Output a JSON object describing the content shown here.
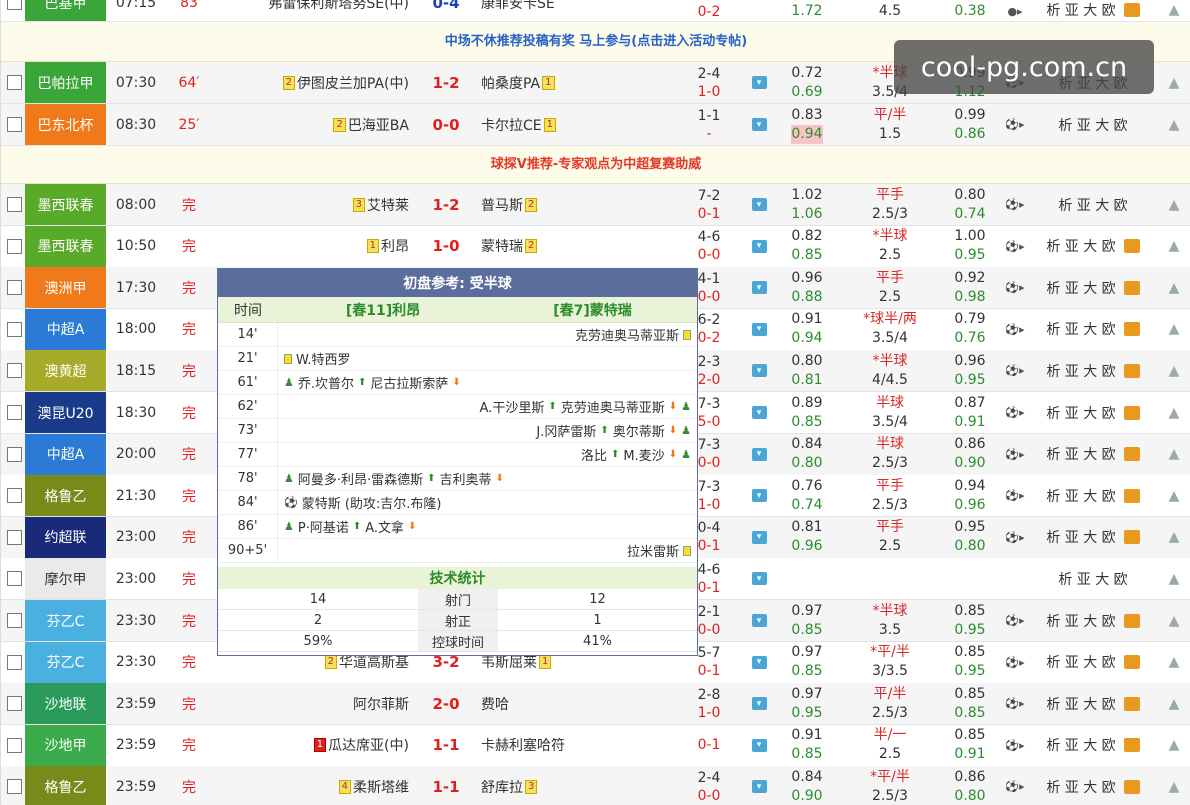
{
  "top_row": {
    "league": "巴基甲",
    "league_color": "#3aa63a",
    "time": "07:15",
    "status": "83",
    "home": "弗雷保利斯塔努SE(中)",
    "score": "0-4",
    "away": "康菲安卡SE",
    "hf_top": "0-2",
    "hf_bottom": "",
    "o1a": "1.72",
    "o2a": "4.5",
    "o3a": "0.38"
  },
  "banners": {
    "b1": "中场不休推荐投稿有奖 马上参与(点击进入活动专帖)",
    "b2": "球探V推荐-专家观点为中超复赛助威"
  },
  "live_rows": [
    {
      "league": "巴帕拉甲",
      "color": "#3aa63a",
      "time": "07:30",
      "status": "64′",
      "home_rank": "2",
      "home": "伊图皮兰加PA(中)",
      "score_h": "1",
      "score_a": "2",
      "away": "帕桑度PA",
      "away_rank": "1",
      "hf1": "2-4",
      "hf2": "1-0",
      "o1a": "0.72",
      "o1b": "0.69",
      "o2a": "*半球",
      "o2b": "3.5/4",
      "o3a": "0.99",
      "o3b": "1.12"
    },
    {
      "league": "巴东北杯",
      "color": "#f07a1a",
      "time": "08:30",
      "status": "25′",
      "home_rank": "2",
      "home": "巴海亚BA",
      "score_h": "0",
      "score_a": "0",
      "away": "卡尔拉CE",
      "away_rank": "1",
      "hf1": "1-1",
      "hf2": "-",
      "o1a": "0.83",
      "o1b": "0.94",
      "o2a": "平/半",
      "o2b": "1.5",
      "o3a": "0.99",
      "o3b": "0.86"
    }
  ],
  "finished_rows": [
    {
      "league": "墨西联春",
      "color": "#5aaa2a",
      "time": "08:00",
      "status": "完",
      "home_rank": "3",
      "home": "艾特莱",
      "score_h": "1",
      "score_a": "2",
      "away": "普马斯",
      "away_rank": "2",
      "hf1": "7-2",
      "hf2": "0-1",
      "o1a": "1.02",
      "o1b": "1.06",
      "o2a": "平手",
      "o2b": "2.5/3",
      "o3a": "0.80",
      "o3b": "0.74",
      "pic": false
    },
    {
      "league": "墨西联春",
      "color": "#5aaa2a",
      "time": "10:50",
      "status": "完",
      "home_rank": "1",
      "home": "利昂",
      "score_h": "1",
      "score_a": "0",
      "away": "蒙特瑞",
      "away_rank": "2",
      "hf1": "4-6",
      "hf2": "0-0",
      "o1a": "0.82",
      "o1b": "0.85",
      "o2a": "*半球",
      "o2b": "2.5",
      "o3a": "1.00",
      "o3b": "0.95",
      "pic": true
    },
    {
      "league": "澳洲甲",
      "color": "#f07a1a",
      "time": "17:30",
      "status": "完",
      "home_rank": "",
      "home": "",
      "score_h": "",
      "score_a": "",
      "away": "",
      "away_rank": "",
      "hf1": "4-1",
      "hf2": "0-0",
      "o1a": "0.96",
      "o1b": "0.88",
      "o2a": "平手",
      "o2b": "2.5",
      "o3a": "0.92",
      "o3b": "0.98",
      "pic": true
    },
    {
      "league": "中超A",
      "color": "#2a7ad6",
      "time": "18:00",
      "status": "完",
      "home_rank": "",
      "home": "",
      "score_h": "",
      "score_a": "",
      "away": "",
      "away_rank": "",
      "hf1": "6-2",
      "hf2": "0-2",
      "o1a": "0.91",
      "o1b": "0.94",
      "o2a": "*球半/两",
      "o2b": "3.5/4",
      "o3a": "0.79",
      "o3b": "0.76",
      "pic": true
    },
    {
      "league": "澳黄超",
      "color": "#a8ab2a",
      "time": "18:15",
      "status": "完",
      "home_rank": "",
      "home": "",
      "score_h": "",
      "score_a": "",
      "away": "",
      "away_rank": "",
      "hf1": "2-3",
      "hf2": "2-0",
      "o1a": "0.80",
      "o1b": "0.81",
      "o2a": "*半球",
      "o2b": "4/4.5",
      "o3a": "0.96",
      "o3b": "0.95",
      "pic": true
    },
    {
      "league": "澳昆U20",
      "color": "#1a3a8a",
      "time": "18:30",
      "status": "完",
      "home_rank": "",
      "home": "",
      "score_h": "",
      "score_a": "",
      "away": "",
      "away_rank": "",
      "hf1": "7-3",
      "hf2": "5-0",
      "o1a": "0.89",
      "o1b": "0.85",
      "o2a": "半球",
      "o2b": "3.5/4",
      "o3a": "0.87",
      "o3b": "0.91",
      "pic": true
    },
    {
      "league": "中超A",
      "color": "#2a7ad6",
      "time": "20:00",
      "status": "完",
      "home_rank": "",
      "home": "",
      "score_h": "",
      "score_a": "",
      "away": "",
      "away_rank": "",
      "hf1": "7-3",
      "hf2": "0-0",
      "o1a": "0.84",
      "o1b": "0.80",
      "o2a": "半球",
      "o2b": "2.5/3",
      "o3a": "0.86",
      "o3b": "0.90",
      "pic": true
    },
    {
      "league": "格鲁乙",
      "color": "#7a8a1a",
      "time": "21:30",
      "status": "完",
      "home_rank": "",
      "home": "",
      "score_h": "",
      "score_a": "",
      "away": "",
      "away_rank": "",
      "hf1": "7-3",
      "hf2": "1-0",
      "o1a": "0.76",
      "o1b": "0.74",
      "o2a": "平手",
      "o2b": "2.5/3",
      "o3a": "0.94",
      "o3b": "0.96",
      "pic": true
    },
    {
      "league": "约超联",
      "color": "#1a2a7a",
      "time": "23:00",
      "status": "完",
      "home_rank": "",
      "home": "",
      "score_h": "",
      "score_a": "",
      "away": "",
      "away_rank": "",
      "hf1": "0-4",
      "hf2": "0-1",
      "o1a": "0.81",
      "o1b": "0.96",
      "o2a": "平手",
      "o2b": "2.5",
      "o3a": "0.95",
      "o3b": "0.80",
      "pic": true
    },
    {
      "league": "摩尔甲",
      "color": "#eaeaea",
      "time": "23:00",
      "status": "完",
      "home_rank": "",
      "home": "",
      "score_h": "",
      "score_a": "",
      "away": "",
      "away_rank": "",
      "hf1": "4-6",
      "hf2": "0-1",
      "o1a": "",
      "o1b": "",
      "o2a": "",
      "o2b": "",
      "o3a": "",
      "o3b": "",
      "pic": false,
      "dark": true
    },
    {
      "league": "芬乙C",
      "color": "#4ab0e0",
      "time": "23:30",
      "status": "完",
      "home_rank": "",
      "home": "",
      "score_h": "",
      "score_a": "",
      "away": "",
      "away_rank": "",
      "hf1": "2-1",
      "hf2": "0-0",
      "o1a": "0.97",
      "o1b": "0.85",
      "o2a": "*半球",
      "o2b": "3.5",
      "o3a": "0.85",
      "o3b": "0.95",
      "pic": true
    },
    {
      "league": "芬乙C",
      "color": "#4ab0e0",
      "time": "23:30",
      "status": "完",
      "home_rank": "2",
      "home": "华道高斯基",
      "score_h": "3",
      "score_a": "2",
      "away": "韦斯屈莱",
      "away_rank": "1",
      "hf1": "5-7",
      "hf2": "0-1",
      "o1a": "0.97",
      "o1b": "0.85",
      "o2a": "*平/半",
      "o2b": "3/3.5",
      "o3a": "0.85",
      "o3b": "0.95",
      "pic": true
    },
    {
      "league": "沙地联",
      "color": "#2a9a5a",
      "time": "23:59",
      "status": "完",
      "home_rank": "",
      "home": "阿尔菲斯",
      "score_h": "2",
      "score_a": "0",
      "away": "费哈",
      "away_rank": "",
      "hf1": "2-8",
      "hf2": "1-0",
      "o1a": "0.97",
      "o1b": "0.95",
      "o2a": "平/半",
      "o2b": "2.5/3",
      "o3a": "0.85",
      "o3b": "0.85",
      "pic": true
    },
    {
      "league": "沙地甲",
      "color": "#3aaa4a",
      "time": "23:59",
      "status": "完",
      "home_rank": "1",
      "home": "瓜达席亚(中)",
      "score_h": "1",
      "score_a": "1",
      "away": "卡赫利塞哈符",
      "away_rank": "",
      "hf1": "",
      "hf2": "0-1",
      "o1a": "0.91",
      "o1b": "0.85",
      "o2a": "半/一",
      "o2b": "2.5",
      "o3a": "0.85",
      "o3b": "0.91",
      "pic": true,
      "home_red": true
    },
    {
      "league": "格鲁乙",
      "color": "#7a8a1a",
      "time": "23:59",
      "status": "完",
      "home_rank": "4",
      "home": "柔斯塔维",
      "score_h": "1",
      "score_a": "1",
      "away": "舒库拉",
      "away_rank": "3",
      "hf1": "2-4",
      "hf2": "0-0",
      "o1a": "0.84",
      "o1b": "0.90",
      "o2a": "*平/半",
      "o2b": "2.5/3",
      "o3a": "0.86",
      "o3b": "0.80",
      "pic": true
    }
  ],
  "analysis_label": "析 亚 大 欧",
  "popup": {
    "title": "初盘参考: 受半球",
    "col_time": "时间",
    "home_team": "[春11]利昂",
    "away_team": "[春7]蒙特瑞",
    "events": [
      {
        "t": "14'",
        "side": "away",
        "text": "克劳迪奥马蒂亚斯",
        "kind": "yellow"
      },
      {
        "t": "21'",
        "side": "home",
        "text": "W.特西罗",
        "kind": "yellow"
      },
      {
        "t": "61'",
        "side": "home",
        "text": "乔.坎普尔",
        "text2": "尼古拉斯索萨",
        "kind": "sub"
      },
      {
        "t": "62'",
        "side": "away",
        "text": "A.干沙里斯",
        "text2": "克劳迪奥马蒂亚斯",
        "kind": "sub"
      },
      {
        "t": "73'",
        "side": "away",
        "text": "J.冈萨雷斯",
        "text2": "奥尔蒂斯",
        "kind": "sub"
      },
      {
        "t": "77'",
        "side": "away",
        "text": "洛比",
        "text2": "M.麦沙",
        "kind": "sub"
      },
      {
        "t": "78'",
        "side": "home",
        "text": "阿曼多·利昂·雷森德斯",
        "text2": "吉利奥蒂",
        "kind": "sub"
      },
      {
        "t": "84'",
        "side": "home",
        "text": "蒙特斯 (助攻:吉尔.布隆)",
        "kind": "goal"
      },
      {
        "t": "86'",
        "side": "home",
        "text": "P·阿基诺",
        "text2": "A.文拿",
        "kind": "sub"
      },
      {
        "t": "90+5'",
        "side": "away",
        "text": "拉米雷斯",
        "kind": "yellow"
      }
    ],
    "stats_title": "技术统计",
    "stats": [
      {
        "l": "14",
        "label": "射门",
        "r": "12"
      },
      {
        "l": "2",
        "label": "射正",
        "r": "1"
      },
      {
        "l": "59%",
        "label": "控球时间",
        "r": "41%"
      }
    ]
  },
  "watermark": "cool-pg.com.cn"
}
